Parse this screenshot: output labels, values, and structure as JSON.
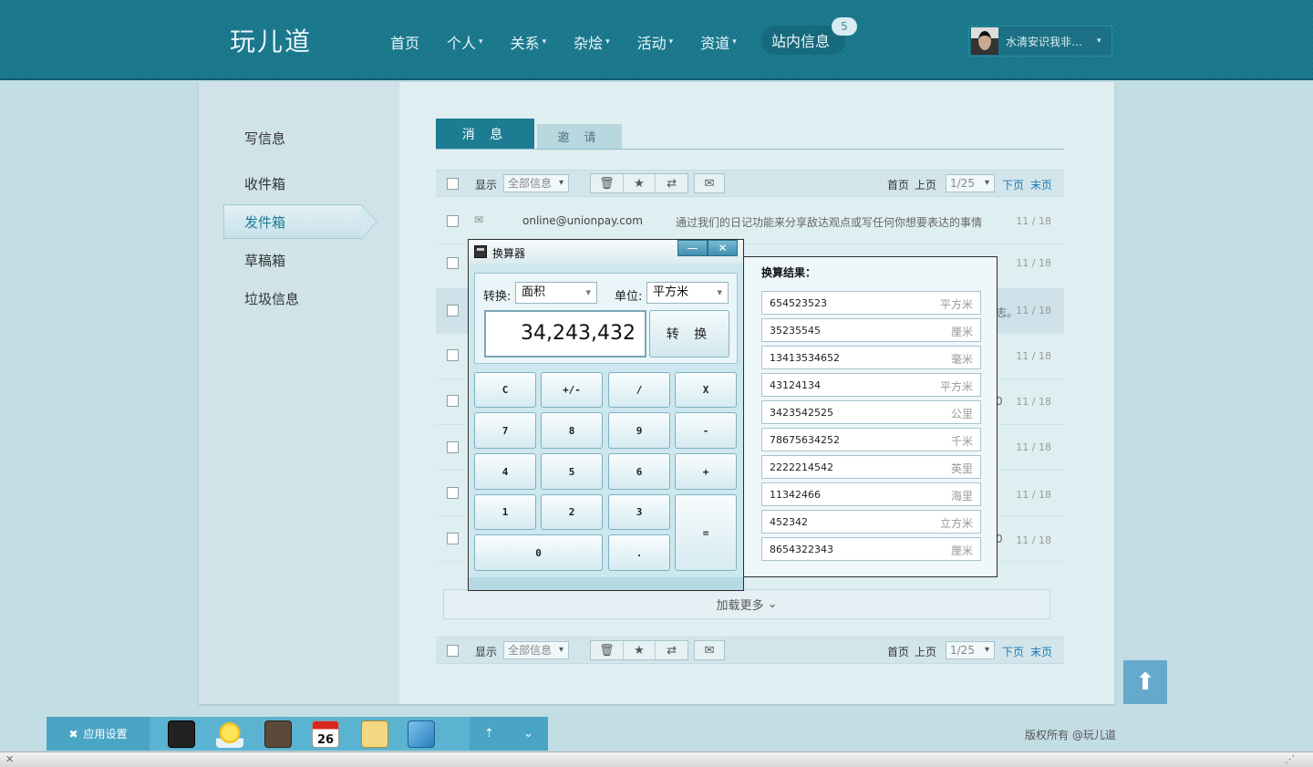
{
  "logo": "玩儿道",
  "nav": {
    "items": [
      "首页",
      "个人",
      "关系",
      "杂烩",
      "活动",
      "资道"
    ],
    "messages": "站内信息",
    "badge": "5"
  },
  "user": {
    "name": "水清安识我非…"
  },
  "sidebar": {
    "items": [
      "写信息",
      "收件箱",
      "发件箱",
      "草稿箱",
      "垃圾信息"
    ],
    "active": "发件箱"
  },
  "tabs": {
    "messages": "消 息",
    "invites": "邀 请"
  },
  "toolbar": {
    "show_label": "显示",
    "filter_value": "全部信息",
    "first": "首页",
    "prev": "上页",
    "page_value": "1/25",
    "next": "下页",
    "last": "末页"
  },
  "rows": [
    {
      "sender": "online@unionpay.com",
      "text": "通过我们的日记功能来分享敌达观点或写任何你想要表达的事情",
      "date": "11 / 18"
    },
    {
      "date": "11 / 18"
    },
    {
      "tail": "志。",
      "date": "11 / 18"
    },
    {
      "date": "11 / 18"
    },
    {
      "tail": "0",
      "date": "11 / 18"
    },
    {
      "date": "11 / 18"
    },
    {
      "date": "11 / 18"
    },
    {
      "tail": "0",
      "date": "11 / 18"
    }
  ],
  "load_more": "加载更多",
  "calculator": {
    "title": "换算器",
    "convert_label": "转换:",
    "convert_value": "面积",
    "unit_label": "单位:",
    "unit_value": "平方米",
    "display": "34,243,432",
    "convert_button": "转 换",
    "keys": [
      "C",
      "+/-",
      "/",
      "X",
      "7",
      "8",
      "9",
      "-",
      "4",
      "5",
      "6",
      "+",
      "1",
      "2",
      "3",
      "=",
      "0",
      "."
    ]
  },
  "result": {
    "title": "换算结果：",
    "rows": [
      {
        "value": "654523523",
        "unit": "平方米"
      },
      {
        "value": "35235545",
        "unit": "厘米"
      },
      {
        "value": "13413534652",
        "unit": "毫米"
      },
      {
        "value": "43124134",
        "unit": "平方米"
      },
      {
        "value": "3423542525",
        "unit": "公里"
      },
      {
        "value": "78675634252",
        "unit": "千米"
      },
      {
        "value": "2222214542",
        "unit": "英里"
      },
      {
        "value": "11342466",
        "unit": "海里"
      },
      {
        "value": "452342",
        "unit": "立方米"
      },
      {
        "value": "8654322343",
        "unit": "厘米"
      }
    ]
  },
  "dock": {
    "settings": "应用设置"
  },
  "copyright": "版权所有 @玩儿道",
  "colors": {
    "brand": "#1d7c91",
    "link": "#1a7ab8",
    "dock": "#5ab3d0"
  }
}
